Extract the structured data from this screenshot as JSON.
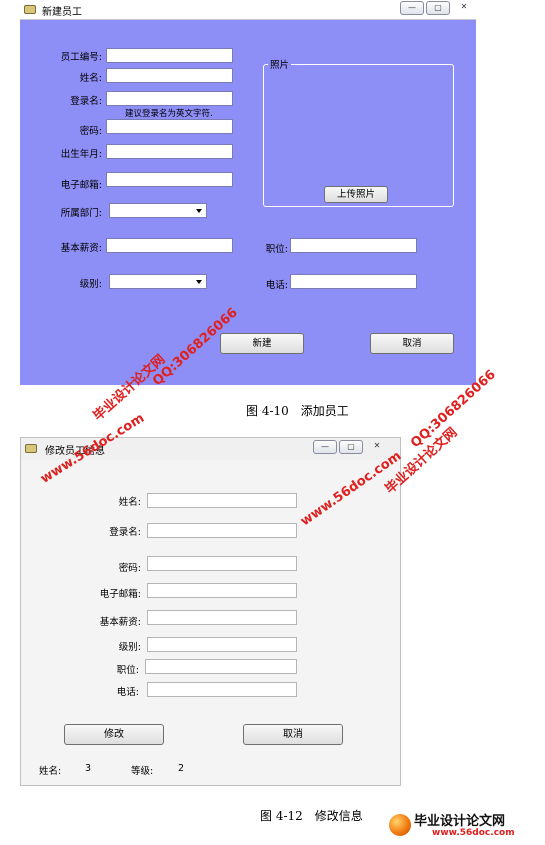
{
  "window1": {
    "title": "新建员工",
    "controls": {
      "min": "—",
      "max": "▢",
      "close": "✕"
    },
    "labels": {
      "employee_id": "员工编号:",
      "name": "姓名:",
      "login": "登录名:",
      "password": "密码:",
      "birth": "出生年月:",
      "email": "电子邮箱:",
      "department": "所属部门:",
      "salary": "基本薪资:",
      "level": "级别:",
      "position": "职位:",
      "phone": "电话:"
    },
    "login_hint": "建议登录名为英文字符.",
    "photo_group": "照片",
    "upload_button": "上传照片",
    "create_button": "新建",
    "cancel_button": "取消"
  },
  "caption1": "图 4-10　添加员工",
  "window2": {
    "title": "修改员工信息",
    "controls": {
      "min": "—",
      "max": "▢",
      "close": "✕"
    },
    "labels": {
      "name": "姓名:",
      "login": "登录名:",
      "password": "密码:",
      "email": "电子邮箱:",
      "salary": "基本薪资:",
      "level": "级别:",
      "position": "职位:",
      "phone": "电话:"
    },
    "modify_button": "修改",
    "cancel_button": "取消",
    "status": {
      "name_label": "姓名:",
      "name_value": "3",
      "grade_label": "等级:",
      "grade_value": "2"
    }
  },
  "caption2": "图 4-12　修改信息",
  "watermarks": {
    "site_name": "毕业设计论文网",
    "url": "www.56doc.com",
    "qq": "QQ:306826066"
  },
  "logo": {
    "name": "毕业设计论文网",
    "url": "www.56doc.com"
  }
}
